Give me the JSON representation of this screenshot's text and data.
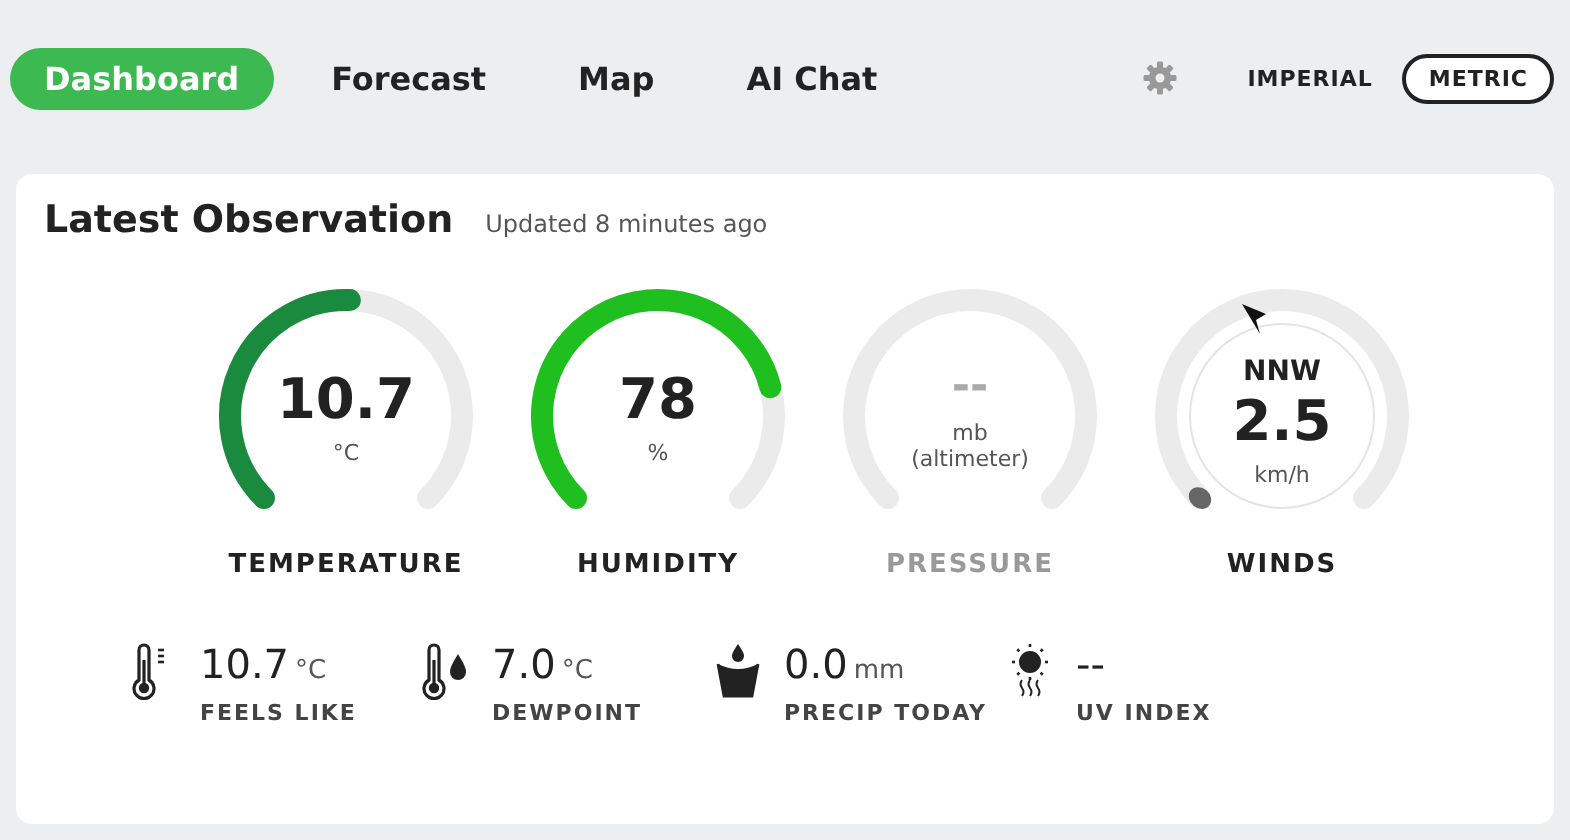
{
  "tabs": [
    {
      "label": "Dashboard",
      "selected": true
    },
    {
      "label": "Forecast",
      "selected": false
    },
    {
      "label": "Map",
      "selected": false
    },
    {
      "label": "AI Chat",
      "selected": false
    }
  ],
  "units": [
    {
      "label": "IMPERIAL",
      "selected": false
    },
    {
      "label": "METRIC",
      "selected": true
    }
  ],
  "card": {
    "title": "Latest Observation",
    "updated": "Updated 8 minutes ago"
  },
  "gauges": [
    {
      "kind": "temperature",
      "value": "10.7",
      "unit": "°C",
      "label": "TEMPERATURE",
      "disabled": false
    },
    {
      "kind": "humidity",
      "value": "78",
      "unit": "%",
      "label": "HUMIDITY",
      "disabled": false
    },
    {
      "kind": "pressure",
      "value": "--",
      "unit": "mb\n(altimeter)",
      "label": "PRESSURE",
      "disabled": true
    },
    {
      "kind": "wind",
      "direction": "NNW",
      "value": "2.5",
      "unit": "km/h",
      "label": "WINDS",
      "disabled": false
    }
  ],
  "stats": [
    {
      "kind": "feels",
      "value": "10.7",
      "unit": "°C",
      "label": "FEELS LIKE"
    },
    {
      "kind": "dew",
      "value": "7.0",
      "unit": "°C",
      "label": "DEWPOINT"
    },
    {
      "kind": "precip",
      "value": "0.0",
      "unit": "mm",
      "label": "PRECIP TODAY"
    },
    {
      "kind": "uv",
      "value": "--",
      "label": "UV INDEX"
    }
  ]
}
